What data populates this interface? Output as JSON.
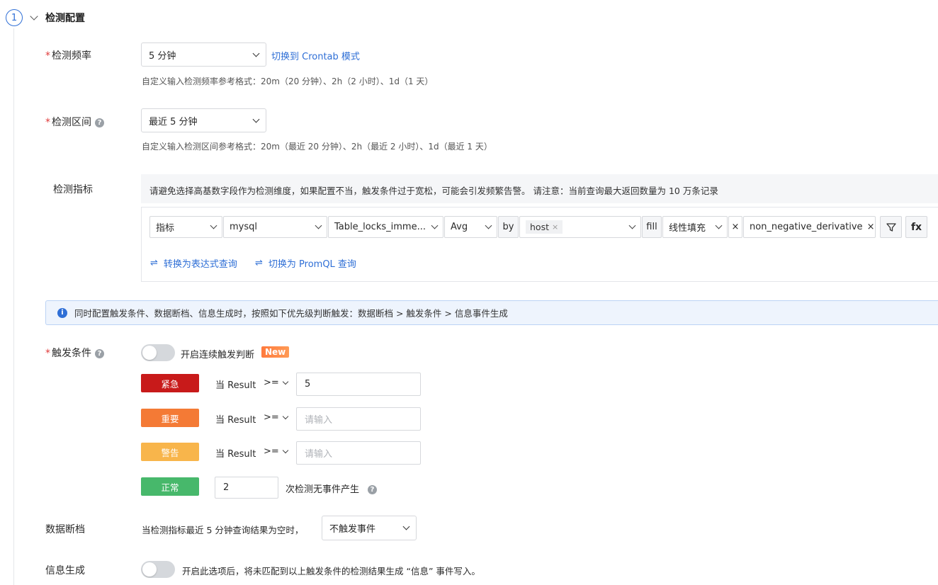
{
  "section": {
    "number": "1",
    "title": "检测配置"
  },
  "frequency": {
    "label": "检测频率",
    "required_mark": "*",
    "value": "5 分钟",
    "switch_link": "切换到 Crontab 模式",
    "hint": "自定义输入检测频率参考格式：20m（20 分钟）、2h（2 小时）、1d（1 天）"
  },
  "range": {
    "label": "检测区间",
    "required_mark": "*",
    "value": "最近 5 分钟",
    "hint": "自定义输入检测区间参考格式：20m（最近 20 分钟）、2h（最近 2 小时）、1d（最近 1 天）"
  },
  "metric": {
    "label": "检测指标",
    "warning": "请避免选择高基数字段作为检测维度，如果配置不当，触发条件过于宽松，可能会引发频繁告警。 请注意：当前查询最大返回数量为 10 万条记录",
    "type": "指标",
    "source": "mysql",
    "field": "Table_locks_imme...",
    "aggregation": "Avg",
    "by_label": "by",
    "group_tag": "host",
    "tag_remove": "×",
    "fill_label": "fill",
    "fill_value": "线性填充",
    "func_remove": "×",
    "function": "non_negative_derivative",
    "func_clear": "×",
    "fx_label": "fx",
    "convert_expression": "转换为表达式查询",
    "convert_promql": "切换为 PromQL 查询"
  },
  "info_bar": {
    "icon": "i",
    "text": "同时配置触发条件、数据断档、信息生成时，按照如下优先级判断触发：数据断档 > 触发条件 > 信息事件生成"
  },
  "trigger": {
    "label": "触发条件",
    "required_mark": "*",
    "toggle_label": "开启连续触发判断",
    "new_badge": "New",
    "levels": [
      {
        "name": "紧急",
        "color": "#c81a1a",
        "cond": "当 Result",
        "op": ">=",
        "value": "5",
        "placeholder": "请输入"
      },
      {
        "name": "重要",
        "color": "#f47a35",
        "cond": "当 Result",
        "op": ">=",
        "value": "",
        "placeholder": "请输入"
      },
      {
        "name": "警告",
        "color": "#f8b54b",
        "cond": "当 Result",
        "op": ">=",
        "value": "",
        "placeholder": "请输入"
      }
    ],
    "normal": {
      "name": "正常",
      "color": "#47b86b",
      "value": "2",
      "suffix": "次检测无事件产生"
    }
  },
  "nodata": {
    "label": "数据断档",
    "text": "当检测指标最近 5 分钟查询结果为空时，",
    "value": "不触发事件"
  },
  "info_gen": {
    "label": "信息生成",
    "text": "开启此选项后，将未匹配到以上触发条件的检测结果生成 “信息” 事件写入。"
  }
}
